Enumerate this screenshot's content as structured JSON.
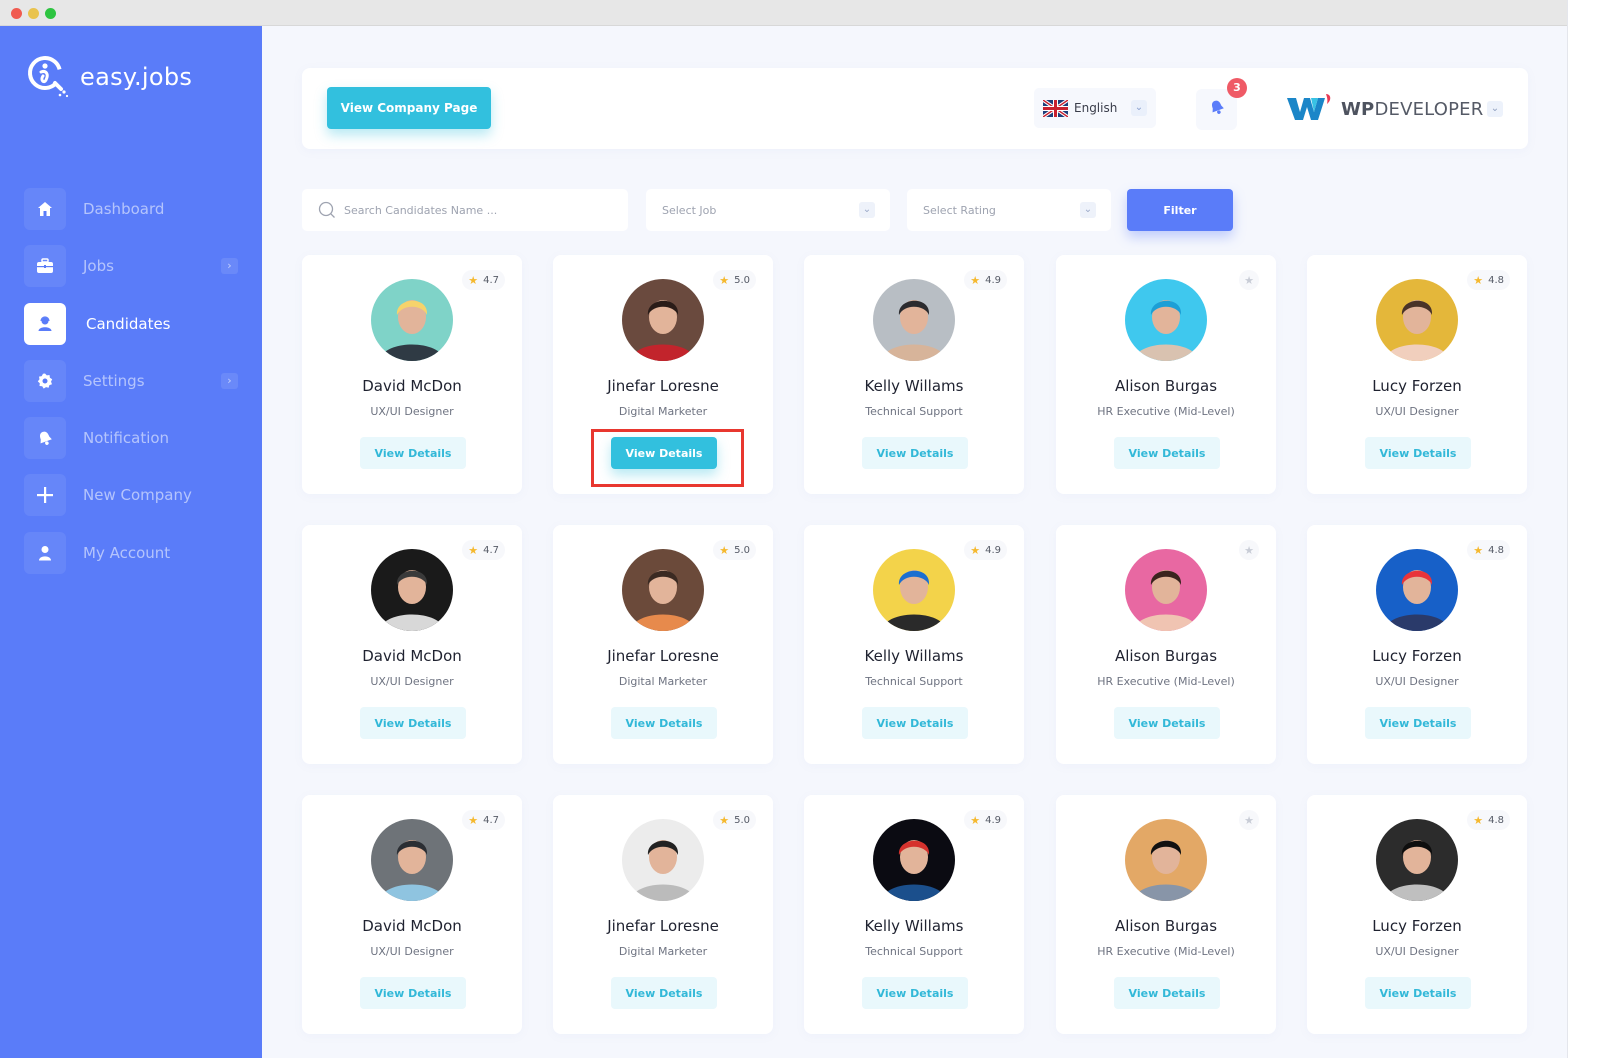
{
  "app": {
    "name": "easy.jobs"
  },
  "sidebar": {
    "items": [
      {
        "id": "dashboard",
        "label": "Dashboard",
        "icon": "home-icon",
        "active": false,
        "has_submenu": false
      },
      {
        "id": "jobs",
        "label": "Jobs",
        "icon": "briefcase-icon",
        "active": false,
        "has_submenu": true
      },
      {
        "id": "candidates",
        "label": "Candidates",
        "icon": "user-headset-icon",
        "active": true,
        "has_submenu": false
      },
      {
        "id": "settings",
        "label": "Settings",
        "icon": "gear-icon",
        "active": false,
        "has_submenu": true
      },
      {
        "id": "notification",
        "label": "Notification",
        "icon": "bell-icon",
        "active": false,
        "has_submenu": false
      },
      {
        "id": "new-company",
        "label": "New Company",
        "icon": "plus-icon",
        "active": false,
        "has_submenu": false
      },
      {
        "id": "my-account",
        "label": "My Account",
        "icon": "user-icon",
        "active": false,
        "has_submenu": false
      }
    ],
    "chevron": "›"
  },
  "header": {
    "view_company_label": "View Company Page",
    "language": "English",
    "notification_count": "3",
    "company_name_bold": "WP",
    "company_name_rest": "DEVELOPER",
    "chevron": "⌄"
  },
  "filters": {
    "search_placeholder": "Search Candidates Name ...",
    "search_value": "",
    "job_select": "Select Job",
    "rating_select": "Select Rating",
    "filter_label": "Filter",
    "chevron": "⌄"
  },
  "colors": {
    "sidebar": "#5a7cf9",
    "accent_cyan": "#32c0de",
    "accent_blue": "#5a7cf9",
    "badge_red": "#ef5a66",
    "highlight_red": "#e8372f",
    "star": "#f5b82e"
  },
  "candidates": [
    {
      "name": "David McDon",
      "role": "UX/UI Designer",
      "rating": "4.7",
      "button": "View Details",
      "avatar": [
        "#7fd3c8",
        "#f6d36b",
        "#2f3a44"
      ]
    },
    {
      "name": "Jinefar Loresne",
      "role": "Digital Marketer",
      "rating": "5.0",
      "button": "View Details",
      "avatar": [
        "#6a4a3e",
        "#2a1c18",
        "#c2242c"
      ],
      "highlighted": true
    },
    {
      "name": "Kelly Willams",
      "role": "Technical Support",
      "rating": "4.9",
      "button": "View Details",
      "avatar": [
        "#b8bec4",
        "#2b2b2e",
        "#d7b49a"
      ]
    },
    {
      "name": "Alison Burgas",
      "role": "HR Executive (Mid-Level)",
      "rating": "",
      "button": "View Details",
      "avatar": [
        "#3fc8ee",
        "#1c9fd6",
        "#d9c2b0"
      ]
    },
    {
      "name": "Lucy Forzen",
      "role": "UX/UI Designer",
      "rating": "4.8",
      "button": "View Details",
      "avatar": [
        "#e4b73a",
        "#4a3328",
        "#f1cfbd"
      ]
    },
    {
      "name": "David McDon",
      "role": "UX/UI Designer",
      "rating": "4.7",
      "button": "View Details",
      "avatar": [
        "#1a1a1a",
        "#3a3a3a",
        "#d8d8d8"
      ]
    },
    {
      "name": "Jinefar Loresne",
      "role": "Digital Marketer",
      "rating": "5.0",
      "button": "View Details",
      "avatar": [
        "#6b4a3a",
        "#3b2a22",
        "#e78a4c"
      ]
    },
    {
      "name": "Kelly Willams",
      "role": "Technical Support",
      "rating": "4.9",
      "button": "View Details",
      "avatar": [
        "#f3d34a",
        "#1c6fd0",
        "#2a2a2a"
      ]
    },
    {
      "name": "Alison Burgas",
      "role": "HR Executive (Mid-Level)",
      "rating": "",
      "button": "View Details",
      "avatar": [
        "#e868a2",
        "#3a241e",
        "#f0c4b2"
      ]
    },
    {
      "name": "Lucy Forzen",
      "role": "UX/UI Designer",
      "rating": "4.8",
      "button": "View Details",
      "avatar": [
        "#1760c8",
        "#e8343a",
        "#2a3a6a"
      ]
    },
    {
      "name": "David McDon",
      "role": "UX/UI Designer",
      "rating": "4.7",
      "button": "View Details",
      "avatar": [
        "#6e7378",
        "#2b2e33",
        "#8fc4e0"
      ]
    },
    {
      "name": "Jinefar Loresne",
      "role": "Digital Marketer",
      "rating": "5.0",
      "button": "View Details",
      "avatar": [
        "#ececec",
        "#222222",
        "#bbbbbb"
      ]
    },
    {
      "name": "Kelly Willams",
      "role": "Technical Support",
      "rating": "4.9",
      "button": "View Details",
      "avatar": [
        "#0b0b12",
        "#d5322d",
        "#1b4f8c"
      ]
    },
    {
      "name": "Alison Burgas",
      "role": "HR Executive (Mid-Level)",
      "rating": "",
      "button": "View Details",
      "avatar": [
        "#e3a866",
        "#111111",
        "#8895a8"
      ]
    },
    {
      "name": "Lucy Forzen",
      "role": "UX/UI Designer",
      "rating": "4.8",
      "button": "View Details",
      "avatar": [
        "#2c2c2c",
        "#0e0e0e",
        "#bfbfbf"
      ]
    }
  ]
}
